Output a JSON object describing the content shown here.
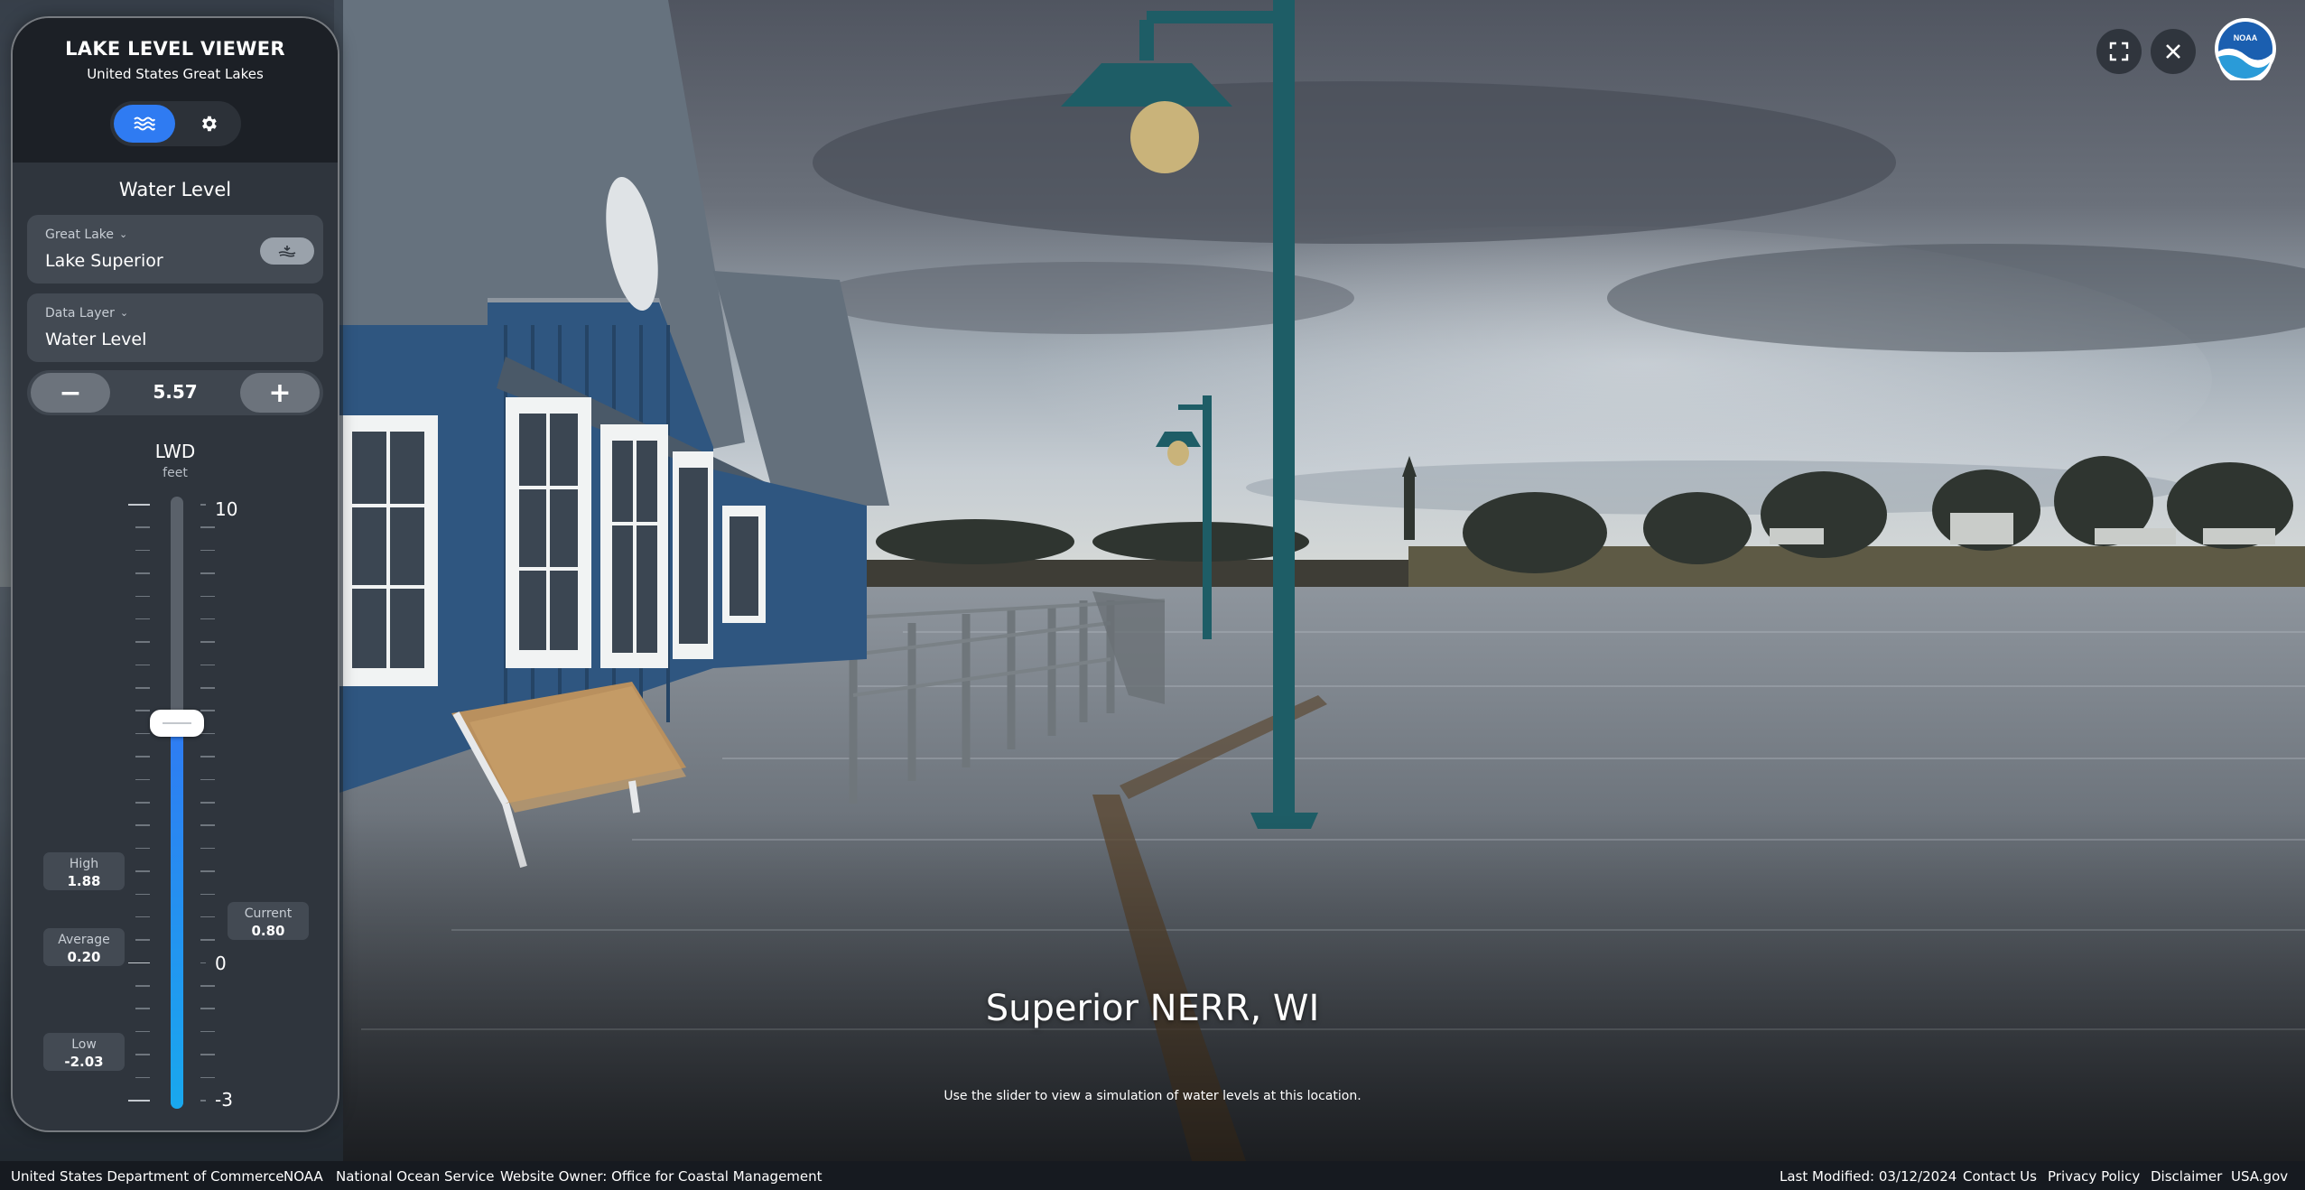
{
  "app": {
    "title": "LAKE LEVEL VIEWER",
    "subtitle": "United States Great Lakes"
  },
  "mode_tabs": [
    {
      "icon": "waves-icon",
      "active": true
    },
    {
      "icon": "gear-icon",
      "active": false
    }
  ],
  "panel": {
    "section_title": "Water Level",
    "great_lake": {
      "label": "Great Lake",
      "value": "Lake Superior"
    },
    "data_layer": {
      "label": "Data Layer",
      "value": "Water Level"
    },
    "stepper": {
      "minus": "−",
      "plus": "+",
      "value": "5.57"
    },
    "datum": "LWD",
    "unit": "feet"
  },
  "gauge": {
    "scale_labels": {
      "top": "10",
      "middle": "0",
      "bottom": "-3"
    },
    "level_fraction": 0.63,
    "stats": {
      "high": {
        "label": "High",
        "value": "1.88"
      },
      "average": {
        "label": "Average",
        "value": "0.20"
      },
      "low": {
        "label": "Low",
        "value": "-2.03"
      },
      "current": {
        "label": "Current",
        "value": "0.80"
      }
    }
  },
  "location": {
    "title": "Superior NERR, WI"
  },
  "hint": "Use the slider to view a simulation of water levels at this location.",
  "top_controls": {
    "fullscreen": "fullscreen-icon",
    "close": "close-icon",
    "logo_text": "NOAA"
  },
  "footer": {
    "left": [
      "United States Department of Commerce",
      "NOAA",
      "National Ocean Service",
      "Website Owner: Office for Coastal Management"
    ],
    "right": [
      "Last Modified: 03/12/2024",
      "Contact Us",
      "Privacy Policy",
      "Disclaimer",
      "USA.gov"
    ]
  },
  "colors": {
    "accent": "#2f7bf2",
    "panel": "#2f353d",
    "footer": "#161a20"
  }
}
